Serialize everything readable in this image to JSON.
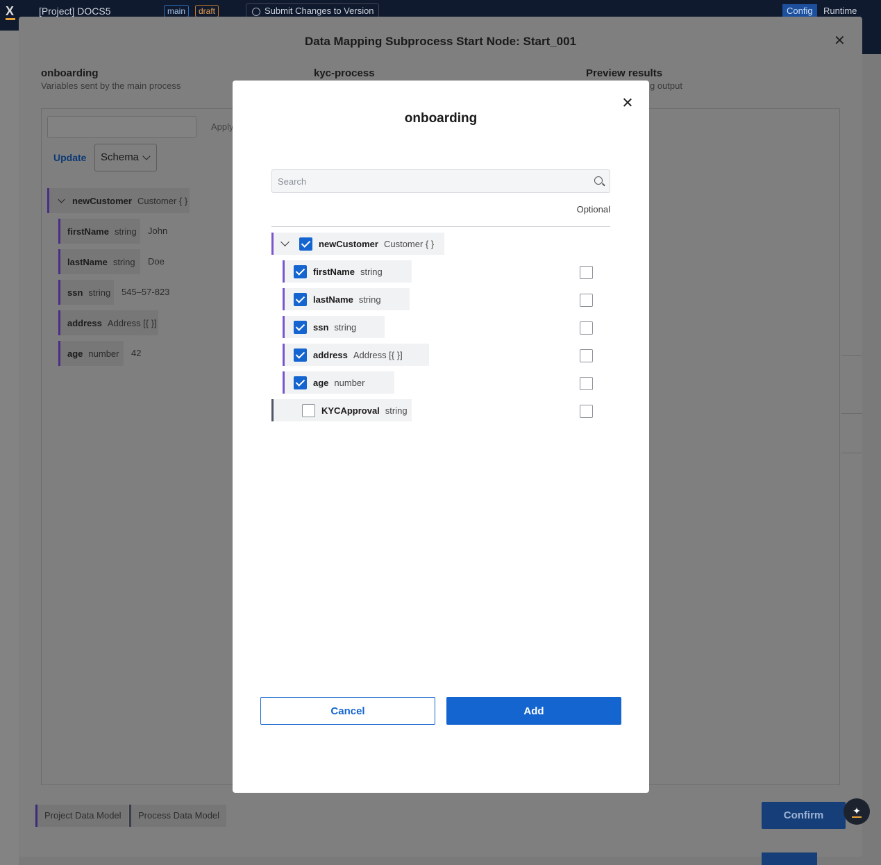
{
  "appbar": {
    "project": "[Project] DOCS5",
    "branch": "main",
    "state": "draft",
    "submit_label": "Submit Changes to Version",
    "mode_active": "Config",
    "mode_other": "Runtime"
  },
  "outer_dialog": {
    "title": "Data Mapping Subprocess Start Node: Start_001",
    "columns": [
      {
        "heading": "onboarding",
        "subtitle": "Variables sent by the main process"
      },
      {
        "heading": "kyc-process",
        "subtitle": ""
      },
      {
        "heading": "Preview results",
        "subtitle": "g output"
      }
    ],
    "apply_label": "Apply",
    "update_label": "Update",
    "schema_select": "Schema",
    "tree": {
      "parent": {
        "name": "newCustomer",
        "type": "Customer { }"
      },
      "children": [
        {
          "name": "firstName",
          "type": "string",
          "value": "John"
        },
        {
          "name": "lastName",
          "type": "string",
          "value": "Doe"
        },
        {
          "name": "ssn",
          "type": "string",
          "value": "545–57-823"
        },
        {
          "name": "address",
          "type": "Address [{ }]",
          "value": ""
        },
        {
          "name": "age",
          "type": "number",
          "value": "42"
        }
      ]
    },
    "data_model_tags": [
      "Project Data Model",
      "Process Data Model"
    ],
    "confirm_label": "Confirm"
  },
  "modal": {
    "title": "onboarding",
    "search": {
      "placeholder": "Search",
      "value": ""
    },
    "optional_header": "Optional",
    "parent": {
      "name": "newCustomer",
      "type": "Customer { }",
      "checked": true
    },
    "children": [
      {
        "name": "firstName",
        "type": "string",
        "checked": true,
        "optional": false
      },
      {
        "name": "lastName",
        "type": "string",
        "checked": true,
        "optional": false
      },
      {
        "name": "ssn",
        "type": "string",
        "checked": true,
        "optional": false
      },
      {
        "name": "address",
        "type": "Address [{ }]",
        "checked": true,
        "optional": false
      },
      {
        "name": "age",
        "type": "number",
        "checked": true,
        "optional": false
      }
    ],
    "root_item": {
      "name": "KYCApproval",
      "type": "string",
      "checked": false,
      "optional": false
    },
    "cancel_label": "Cancel",
    "add_label": "Add",
    "colors": {
      "primary": "#1565d0",
      "object_accent": "#7a56cc",
      "primitive_accent": "#4f5665"
    }
  }
}
